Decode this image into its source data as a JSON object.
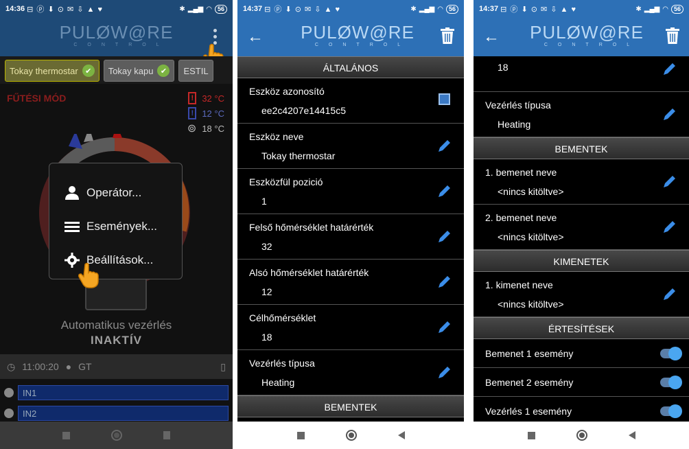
{
  "colors": {
    "appbar": "#2d70b6",
    "appbar_dim": "#1e4a77",
    "section_bg": "#3a3a3a",
    "pen": "#3b8de8",
    "toggle": "#4aa6f0",
    "mode_red": "#8b1d1d",
    "in_bar": "#0f2a6b"
  },
  "screens": [
    {
      "status": {
        "time": "14:36",
        "icons": "⊟ ⓟ ⬇ ⊙ ✉ ⇩ ▲ ♥",
        "battery": "56"
      },
      "logo": {
        "word": "PULØW@RE",
        "sub": "CONTROL"
      },
      "tabs": [
        {
          "label": "Tokay thermostar",
          "active": true
        },
        {
          "label": "Tokay kapu",
          "active": false
        },
        {
          "label": "ESTIL",
          "active": false
        }
      ],
      "mode": "FŰTÉSI MÓD",
      "temps": [
        {
          "value": "32 °C",
          "color": "#c62828",
          "icon": "!"
        },
        {
          "value": "12 °C",
          "color": "#3949ab",
          "icon": "!"
        },
        {
          "value": "18 °C",
          "color": "#bbbbbb",
          "icon": "⊚"
        }
      ],
      "menu": [
        {
          "label": "Operátor...",
          "icon": "person-icon"
        },
        {
          "label": "Események...",
          "icon": "list-icon"
        },
        {
          "label": "Beállítások...",
          "icon": "gear-icon"
        }
      ],
      "auto_label": "Automatikus vezérlés",
      "auto_value": "INAKTÍV",
      "time_info": "11:00:20",
      "user": "GT",
      "inputs": [
        "IN1",
        "IN2"
      ]
    },
    {
      "status": {
        "time": "14:37",
        "icons": "⊟ ⓟ ⬇ ⊙ ✉ ⇩ ▲ ♥",
        "battery": "56"
      },
      "logo": {
        "word": "PULØW@RE",
        "sub": "CONTROL"
      },
      "section_top": "ÁLTALÁNOS",
      "rows": [
        {
          "label": "Eszköz azonosító",
          "value": "ee2c4207e14415c5",
          "action": "qr"
        },
        {
          "label": "Eszköz neve",
          "value": "Tokay thermostar",
          "action": "edit"
        },
        {
          "label": "Eszközfül pozició",
          "value": "1",
          "action": "edit"
        },
        {
          "label": "Felső hőmérséklet határérték",
          "value": "32",
          "action": "edit"
        },
        {
          "label": "Alsó hőmérséklet határérték",
          "value": "12",
          "action": "edit"
        },
        {
          "label": "Célhőmérséklet",
          "value": "18",
          "action": "edit"
        },
        {
          "label": "Vezérlés típusa",
          "value": "Heating",
          "action": "edit"
        }
      ],
      "section_bottom": "BEMENTEK"
    },
    {
      "status": {
        "time": "14:37",
        "icons": "⊟ ⓟ ⬇ ⊙ ✉ ⇩ ▲ ♥",
        "battery": "56"
      },
      "logo": {
        "word": "PULØW@RE",
        "sub": "CONTROL"
      },
      "partial_row_value": "18",
      "row_control_type": {
        "label": "Vezérlés típusa",
        "value": "Heating"
      },
      "section_inputs": "BEMENTEK",
      "inputs": [
        {
          "label": "1. bemenet neve",
          "value": "<nincs kitöltve>"
        },
        {
          "label": "2. bemenet neve",
          "value": "<nincs kitöltve>"
        }
      ],
      "section_outputs": "KIMENETEK",
      "outputs": [
        {
          "label": "1. kimenet neve",
          "value": "<nincs kitöltve>"
        }
      ],
      "section_notifications": "ÉRTESÍTÉSEK",
      "toggles": [
        {
          "label": "Bemenet 1 esemény",
          "on": true
        },
        {
          "label": "Bemenet 2 esemény",
          "on": true
        },
        {
          "label": "Vezérlés 1 esemény",
          "on": true
        }
      ]
    }
  ]
}
